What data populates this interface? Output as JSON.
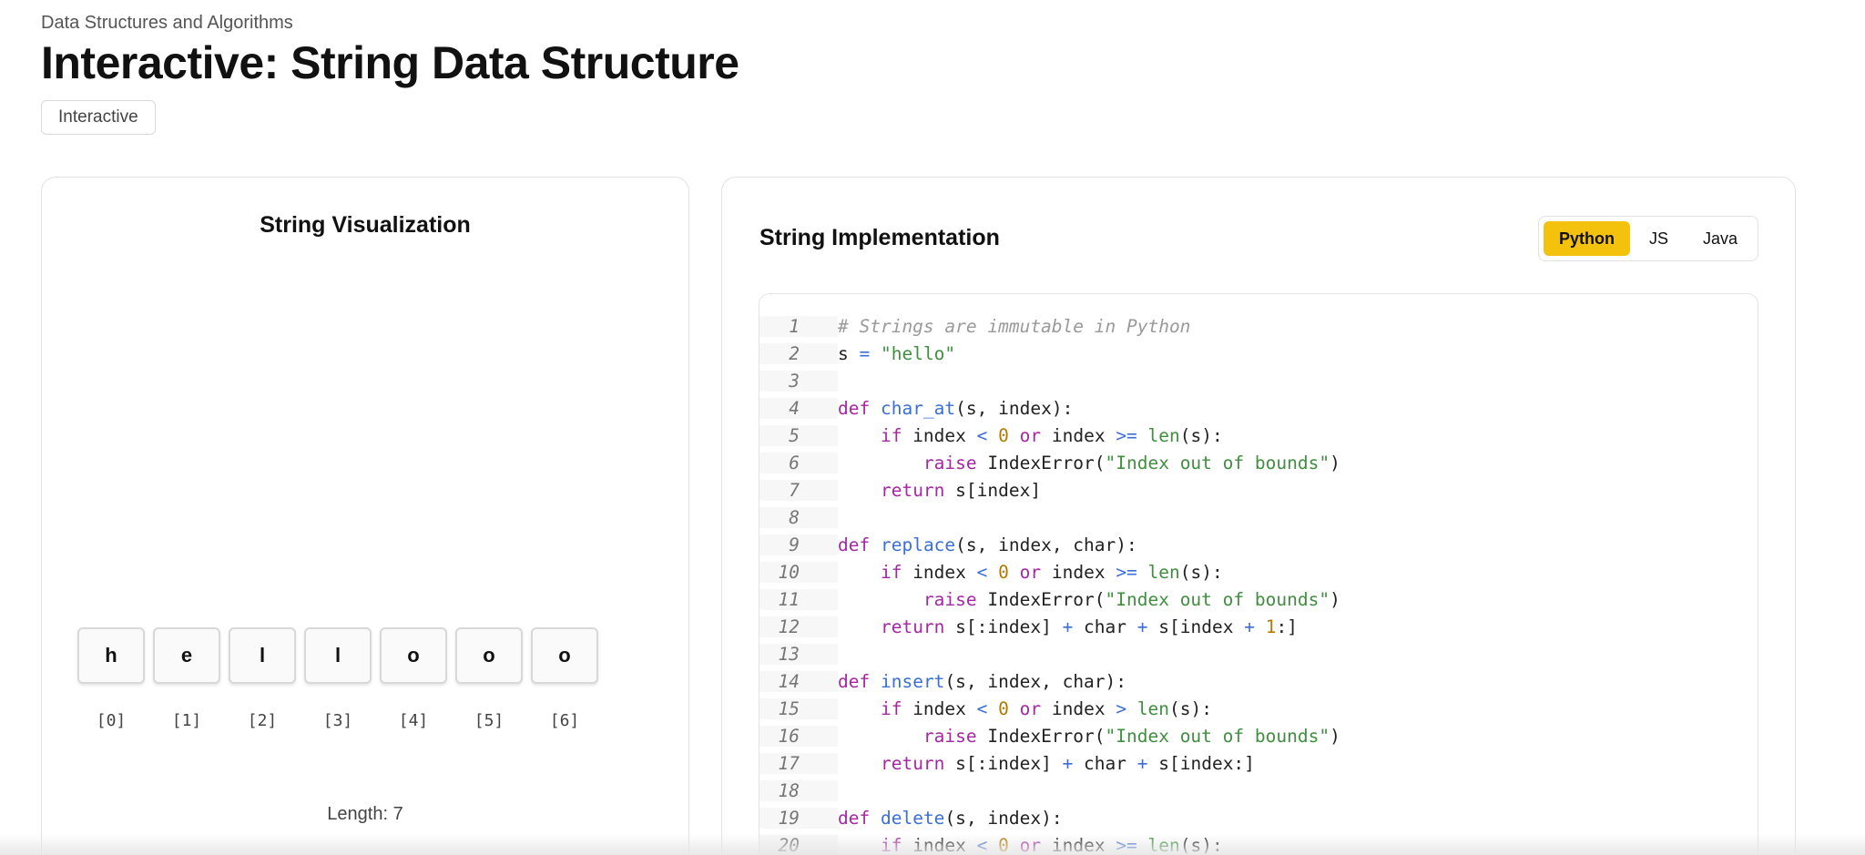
{
  "header": {
    "breadcrumb": "Data Structures and Algorithms",
    "title": "Interactive: String Data Structure",
    "tag": "Interactive"
  },
  "visualization": {
    "title": "String Visualization",
    "chars": [
      {
        "char": "h",
        "index": "[0]"
      },
      {
        "char": "e",
        "index": "[1]"
      },
      {
        "char": "l",
        "index": "[2]"
      },
      {
        "char": "l",
        "index": "[3]"
      },
      {
        "char": "o",
        "index": "[4]"
      },
      {
        "char": "o",
        "index": "[5]"
      },
      {
        "char": "o",
        "index": "[6]"
      }
    ],
    "length_label": "Length: 7"
  },
  "implementation": {
    "title": "String Implementation",
    "languages": [
      {
        "label": "Python",
        "active": true
      },
      {
        "label": "JS",
        "active": false
      },
      {
        "label": "Java",
        "active": false
      }
    ],
    "code_lines": [
      {
        "n": "1",
        "code": "# Strings are immutable in Python"
      },
      {
        "n": "2",
        "code": "s = \"hello\""
      },
      {
        "n": "3",
        "code": ""
      },
      {
        "n": "4",
        "code": "def char_at(s, index):"
      },
      {
        "n": "5",
        "code": "    if index < 0 or index >= len(s):"
      },
      {
        "n": "6",
        "code": "        raise IndexError(\"Index out of bounds\")"
      },
      {
        "n": "7",
        "code": "    return s[index]"
      },
      {
        "n": "8",
        "code": ""
      },
      {
        "n": "9",
        "code": "def replace(s, index, char):"
      },
      {
        "n": "10",
        "code": "    if index < 0 or index >= len(s):"
      },
      {
        "n": "11",
        "code": "        raise IndexError(\"Index out of bounds\")"
      },
      {
        "n": "12",
        "code": "    return s[:index] + char + s[index + 1:]"
      },
      {
        "n": "13",
        "code": ""
      },
      {
        "n": "14",
        "code": "def insert(s, index, char):"
      },
      {
        "n": "15",
        "code": "    if index < 0 or index > len(s):"
      },
      {
        "n": "16",
        "code": "        raise IndexError(\"Index out of bounds\")"
      },
      {
        "n": "17",
        "code": "    return s[:index] + char + s[index:]"
      },
      {
        "n": "18",
        "code": ""
      },
      {
        "n": "19",
        "code": "def delete(s, index):"
      },
      {
        "n": "20",
        "code": "    if index < 0 or index >= len(s):"
      }
    ]
  },
  "colors": {
    "accent": "#f4c10d",
    "keyword": "#a626a4",
    "function": "#3a6fd8",
    "string": "#3f8f3f",
    "number": "#b07b00",
    "comment": "#9a9a9a"
  }
}
